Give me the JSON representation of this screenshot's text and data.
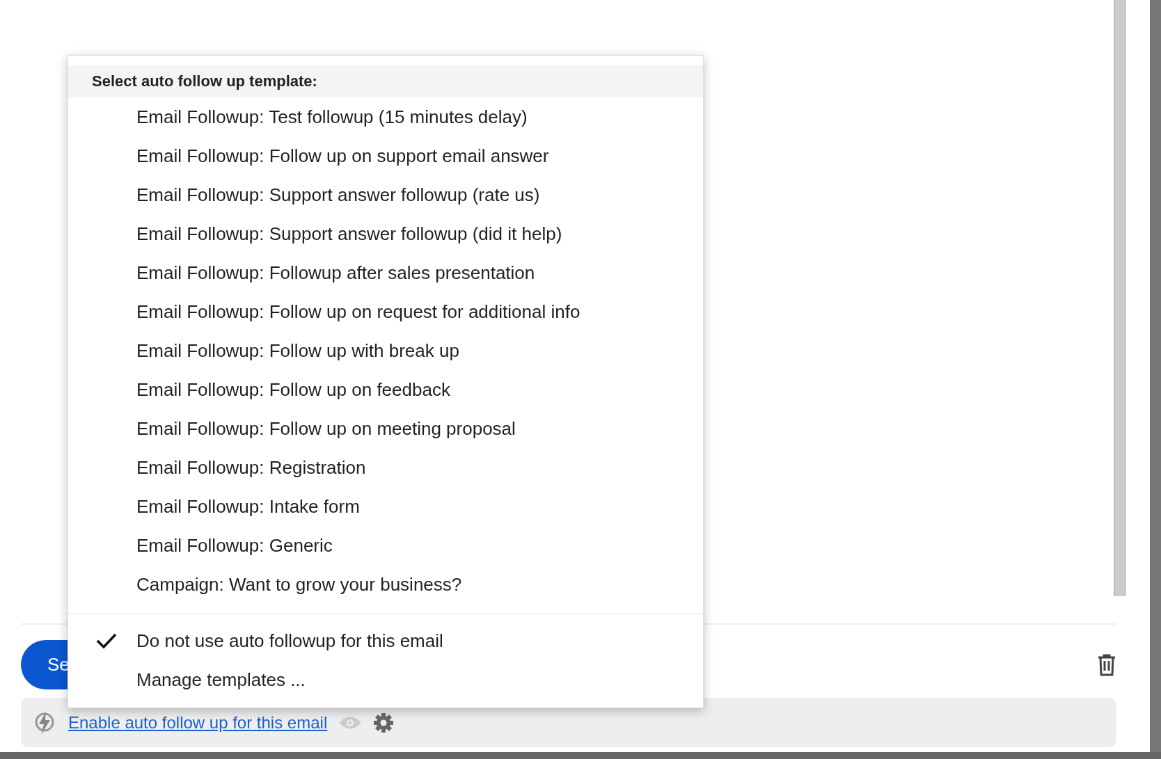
{
  "send_button": {
    "label": "Se"
  },
  "template_menu": {
    "header": "Select auto follow up template:",
    "templates": [
      {
        "label": "Email Followup: Test followup (15 minutes delay)",
        "selected": false
      },
      {
        "label": "Email Followup: Follow up on support email answer",
        "selected": false
      },
      {
        "label": "Email Followup: Support answer followup (rate us)",
        "selected": false
      },
      {
        "label": "Email Followup: Support answer followup (did it help)",
        "selected": false
      },
      {
        "label": "Email Followup: Followup after sales presentation",
        "selected": false
      },
      {
        "label": "Email Followup: Follow up on request for additional info",
        "selected": false
      },
      {
        "label": "Email Followup: Follow up with break up",
        "selected": false
      },
      {
        "label": "Email Followup: Follow up on feedback",
        "selected": false
      },
      {
        "label": "Email Followup: Follow up on meeting proposal",
        "selected": false
      },
      {
        "label": "Email Followup: Registration",
        "selected": false
      },
      {
        "label": "Email Followup: Intake form",
        "selected": false
      },
      {
        "label": "Email Followup: Generic",
        "selected": false
      },
      {
        "label": "Campaign: Want to grow your business?",
        "selected": false
      }
    ],
    "options": [
      {
        "label": "Do not use auto followup for this email",
        "selected": true
      },
      {
        "label": "Manage templates ...",
        "selected": false
      }
    ]
  },
  "followup_bar": {
    "link": "Enable auto follow up for this email"
  }
}
